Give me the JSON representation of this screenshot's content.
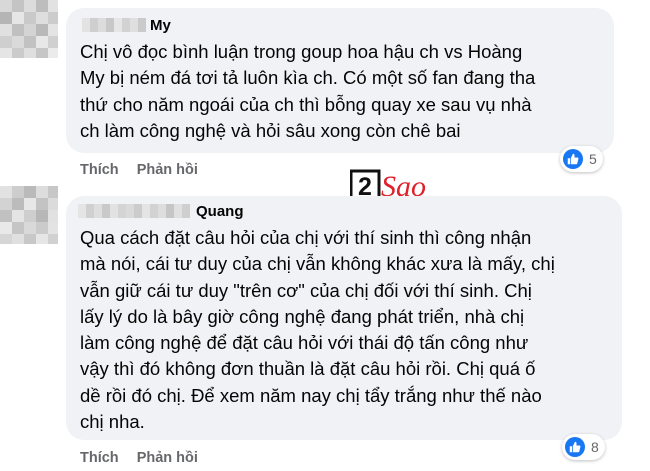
{
  "comments": [
    {
      "author_visible": "My",
      "lines": [
        "Chị vô đọc bình luận trong goup hoa hậu ch vs Hoàng",
        "My bị ném đá tơi tả luôn kìa ch. Có một số fan đang tha",
        "thứ cho năm ngoái của ch thì bỗng quay xe sau vụ nhà",
        "ch làm công nghệ và hỏi sâu xong còn chê bai"
      ],
      "like_label": "Thích",
      "reply_label": "Phản hồi",
      "reaction_icon": "like-icon",
      "reaction_count": "5"
    },
    {
      "author_visible": "Quang",
      "lines": [
        "Qua cách đặt câu hỏi của chị với thí sinh thì công nhận",
        "mà nói, cái tư duy của chị vẫn không khác xưa là mấy, chị",
        "vẫn giữ cái tư duy \"trên cơ\" của chị đối với thí sinh. Chị",
        "lấy lý do là bây giờ công nghệ đang phát triển, nhà chị",
        "làm công nghệ để đặt câu hỏi với thái độ tấn công như",
        "vậy thì đó không đơn thuần là đặt câu hỏi rồi. Chị quá ố",
        "dề rồi đó chị. Để xem năm nay chị tẩy trắng như thế nào",
        "chị nha."
      ],
      "like_label": "Thích",
      "reply_label": "Phản hồi",
      "reaction_icon": "like-icon",
      "reaction_count": "8"
    }
  ],
  "watermark": {
    "number": "2",
    "text": "Sao"
  },
  "colors": {
    "bubble": "#f0f2f5",
    "action_text": "#65676b",
    "like_blue": "#1877f2",
    "watermark_red": "#e0202a"
  }
}
